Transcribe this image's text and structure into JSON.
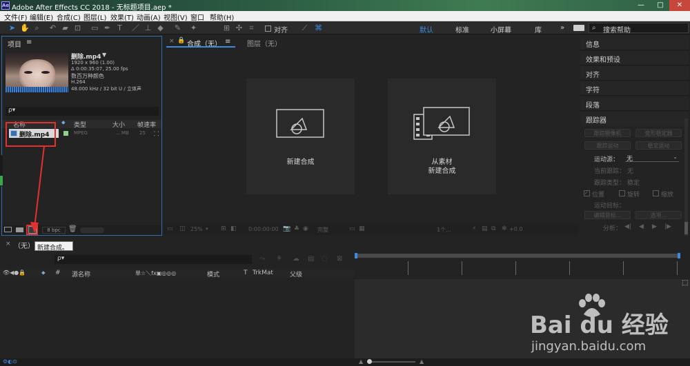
{
  "window": {
    "title": "Adobe After Effects CC 2018 - 无标题项目.aep *",
    "logo_text": "Ae",
    "minimize": "—",
    "maximize": "□",
    "close": "✕"
  },
  "menu": [
    "文件(F)",
    "编辑(E)",
    "合成(C)",
    "图层(L)",
    "效果(T)",
    "动画(A)",
    "视图(V)",
    "窗口",
    "帮助(H)"
  ],
  "toolbar": {
    "align_label": "对齐",
    "workspaces": [
      "默认",
      "标准",
      "小屏幕",
      "库"
    ],
    "more": "»",
    "search_placeholder": "搜索帮助"
  },
  "project": {
    "tab_label": "项目",
    "menu_icon": "≡",
    "file_name": "删除.mp4",
    "file_info": [
      "1920 x 960 (1.00)",
      "Δ 0:00:35:07, 25.00 fps",
      "数百万种颜色",
      "H.264",
      "48.000 kHz / 32 bit U / 立体声"
    ],
    "search_placeholder": "ρ▾",
    "columns": [
      "名称",
      "类型",
      "大小",
      "帧速率"
    ],
    "rows": [
      {
        "name": "删除.mp4",
        "type": "MPEG",
        "size": "... MB",
        "fps": "25"
      }
    ],
    "bpc": "8 bpc"
  },
  "composition": {
    "tab_label": "合成（无）",
    "menu_icon": "≡",
    "layer_tab": "图层（无）",
    "new_comp_label": "新建合成",
    "from_footage_line1": "从素材",
    "from_footage_line2": "新建合成",
    "zoom": "25%",
    "timecode": "0:00:00:00",
    "quality": "完整",
    "views": "1个...",
    "exposure": "+0.0"
  },
  "right_panel": {
    "items": [
      "信息",
      "效果和预设",
      "对齐",
      "字符",
      "段落",
      "跟踪器"
    ],
    "tracker": {
      "track_camera": "跟踪摄像机",
      "warp_stabilizer": "变形稳定器",
      "track_motion": "跟踪运动",
      "stabilize_motion": "稳定运动",
      "motion_source_label": "运动源：",
      "motion_source_value": "无",
      "current_track_label": "当前跟踪：",
      "current_track_value": "无",
      "track_type_label": "跟踪类型：",
      "track_type_value": "稳定",
      "position": "位置",
      "rotation": "旋转",
      "scale": "缩放",
      "motion_target": "运动目标：",
      "edit_target": "编辑目标...",
      "options": "选项...",
      "analyze": "分析："
    }
  },
  "timeline": {
    "close": "×",
    "comp_name": "（无）",
    "tooltip": "新建合成。",
    "search_placeholder": "ρ▾",
    "columns": [
      "#",
      "源名称",
      "单☆＼fx▣◎◎◎",
      "模式",
      "T",
      "TrkMat",
      "父级"
    ]
  },
  "watermark": {
    "brand": "Bai du 经验",
    "url": "jingyan.baidu.com"
  }
}
